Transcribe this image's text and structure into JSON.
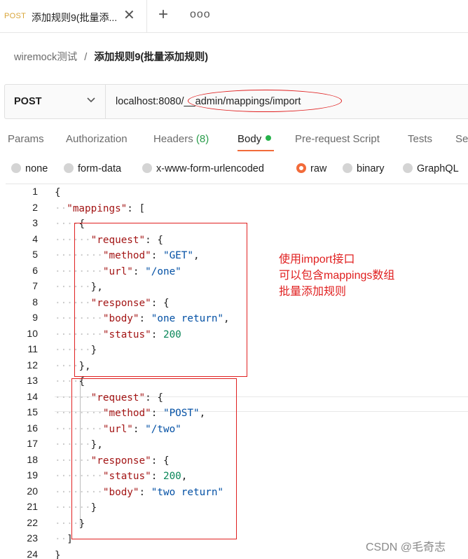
{
  "tab": {
    "method": "POST",
    "title": "添加规则9(批量添...",
    "close": "✕"
  },
  "tabstrip": {
    "new_tab": "+",
    "more": "ooo"
  },
  "breadcrumb": {
    "collection": "wiremock测试",
    "separator": "/",
    "request": "添加规则9(批量添加规则)"
  },
  "request": {
    "method": "POST",
    "url": "localhost:8080/__admin/mappings/import"
  },
  "request_tabs": [
    {
      "label": "Params"
    },
    {
      "label": "Authorization"
    },
    {
      "label": "Headers",
      "count": "(8)"
    },
    {
      "label": "Body",
      "active": true
    },
    {
      "label": "Pre-request Script"
    },
    {
      "label": "Tests"
    },
    {
      "label": "Se"
    }
  ],
  "body_types": [
    {
      "label": "none",
      "selected": false
    },
    {
      "label": "form-data",
      "selected": false
    },
    {
      "label": "x-www-form-urlencoded",
      "selected": false
    },
    {
      "label": "raw",
      "selected": true
    },
    {
      "label": "binary",
      "selected": false
    },
    {
      "label": "GraphQL",
      "selected": false
    }
  ],
  "editor": {
    "line_numbers": [
      "1",
      "2",
      "3",
      "4",
      "5",
      "6",
      "7",
      "8",
      "9",
      "10",
      "11",
      "12",
      "13",
      "14",
      "15",
      "16",
      "17",
      "18",
      "19",
      "20",
      "21",
      "22",
      "23",
      "24"
    ],
    "lines": [
      [
        [
          "p",
          "{"
        ]
      ],
      [
        [
          "ws",
          "··"
        ],
        [
          "k",
          "\"mappings\""
        ],
        [
          "p",
          ": ["
        ]
      ],
      [
        [
          "ws",
          "····"
        ],
        [
          "p",
          "{"
        ]
      ],
      [
        [
          "ws",
          "······"
        ],
        [
          "k",
          "\"request\""
        ],
        [
          "p",
          ": {"
        ]
      ],
      [
        [
          "ws",
          "········"
        ],
        [
          "k",
          "\"method\""
        ],
        [
          "p",
          ": "
        ],
        [
          "s",
          "\"GET\""
        ],
        [
          "p",
          ","
        ]
      ],
      [
        [
          "ws",
          "········"
        ],
        [
          "k",
          "\"url\""
        ],
        [
          "p",
          ": "
        ],
        [
          "s",
          "\"/one\""
        ]
      ],
      [
        [
          "ws",
          "······"
        ],
        [
          "p",
          "},"
        ]
      ],
      [
        [
          "ws",
          "······"
        ],
        [
          "k",
          "\"response\""
        ],
        [
          "p",
          ": {"
        ]
      ],
      [
        [
          "ws",
          "········"
        ],
        [
          "k",
          "\"body\""
        ],
        [
          "p",
          ": "
        ],
        [
          "s",
          "\"one return\""
        ],
        [
          "p",
          ","
        ]
      ],
      [
        [
          "ws",
          "········"
        ],
        [
          "k",
          "\"status\""
        ],
        [
          "p",
          ": "
        ],
        [
          "n",
          "200"
        ]
      ],
      [
        [
          "ws",
          "······"
        ],
        [
          "p",
          "}"
        ]
      ],
      [
        [
          "ws",
          "····"
        ],
        [
          "p",
          "},"
        ]
      ],
      [
        [
          "ws",
          "····"
        ],
        [
          "p",
          "{"
        ]
      ],
      [
        [
          "ws",
          "······"
        ],
        [
          "k",
          "\"request\""
        ],
        [
          "p",
          ": {"
        ]
      ],
      [
        [
          "ws",
          "········"
        ],
        [
          "k",
          "\"method\""
        ],
        [
          "p",
          ": "
        ],
        [
          "s",
          "\"POST\""
        ],
        [
          "p",
          ","
        ]
      ],
      [
        [
          "ws",
          "········"
        ],
        [
          "k",
          "\"url\""
        ],
        [
          "p",
          ": "
        ],
        [
          "s",
          "\"/two\""
        ]
      ],
      [
        [
          "ws",
          "······"
        ],
        [
          "p",
          "},"
        ]
      ],
      [
        [
          "ws",
          "······"
        ],
        [
          "k",
          "\"response\""
        ],
        [
          "p",
          ": {"
        ]
      ],
      [
        [
          "ws",
          "········"
        ],
        [
          "k",
          "\"status\""
        ],
        [
          "p",
          ": "
        ],
        [
          "n",
          "200"
        ],
        [
          "p",
          ","
        ]
      ],
      [
        [
          "ws",
          "········"
        ],
        [
          "k",
          "\"body\""
        ],
        [
          "p",
          ": "
        ],
        [
          "s",
          "\"two return\""
        ]
      ],
      [
        [
          "ws",
          "······"
        ],
        [
          "p",
          "}"
        ]
      ],
      [
        [
          "ws",
          "····"
        ],
        [
          "p",
          "}"
        ]
      ],
      [
        [
          "ws",
          "··"
        ],
        [
          "p",
          "]"
        ]
      ],
      [
        [
          "p",
          "}"
        ]
      ]
    ]
  },
  "annotation": {
    "line1": "使用import接口",
    "line2": "可以包含mappings数组",
    "line3": "批量添加规则"
  },
  "watermark": "CSDN @毛奇志",
  "colors": {
    "accent": "#f26b3a",
    "annotation": "#e02020",
    "method_tab": "#d9a53a",
    "active_dot": "#26b24b"
  }
}
